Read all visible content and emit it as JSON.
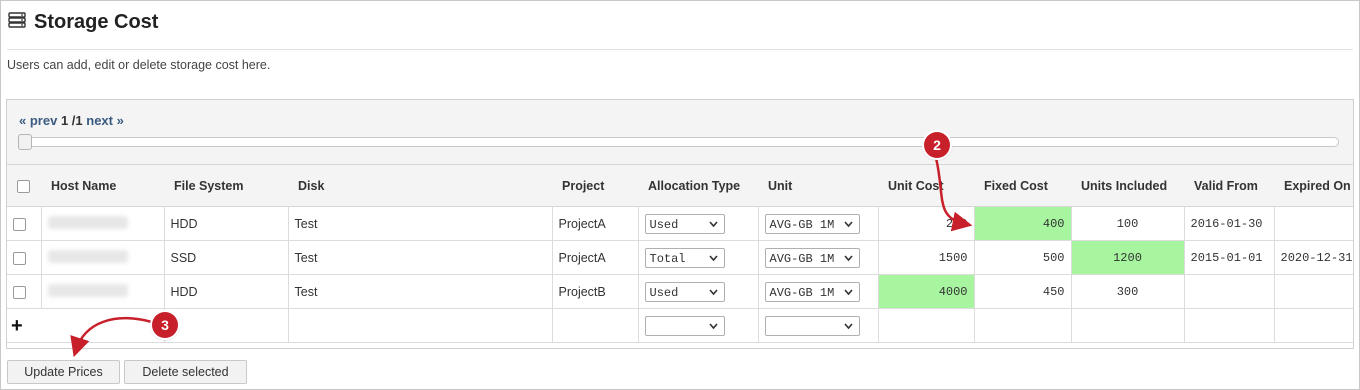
{
  "page": {
    "title": "Storage Cost",
    "description": "Users can add, edit or delete storage cost here."
  },
  "pager": {
    "prev": "« prev",
    "current": "1 /1",
    "next": "next »"
  },
  "table": {
    "columns": [
      "Host Name",
      "File System",
      "Disk",
      "Project",
      "Allocation Type",
      "Unit",
      "Unit Cost",
      "Fixed Cost",
      "Units Included",
      "Valid From",
      "Expired On"
    ],
    "rows": [
      {
        "file_system": "HDD",
        "disk": "Test",
        "project": "ProjectA",
        "allocation_type": "Used",
        "unit": "AVG-GB 1M",
        "unit_cost": "200",
        "fixed_cost": "400",
        "units_included": "100",
        "valid_from": "2016-01-30",
        "expired_on": ""
      },
      {
        "file_system": "SSD",
        "disk": "Test",
        "project": "ProjectA",
        "allocation_type": "Total",
        "unit": "AVG-GB 1M",
        "unit_cost": "1500",
        "fixed_cost": "500",
        "units_included": "1200",
        "valid_from": "2015-01-01",
        "expired_on": "2020-12-31"
      },
      {
        "file_system": "HDD",
        "disk": "Test",
        "project": "ProjectB",
        "allocation_type": "Used",
        "unit": "AVG-GB 1M",
        "unit_cost": "4000",
        "fixed_cost": "450",
        "units_included": "300",
        "valid_from": "",
        "expired_on": ""
      }
    ],
    "add_row_icon": "+",
    "highlight_color": "#a8f5a0"
  },
  "buttons": {
    "update_prices": "Update Prices",
    "delete_selected": "Delete selected"
  },
  "callouts": {
    "badge_2": "2",
    "badge_3": "3",
    "color": "#c8202a"
  }
}
